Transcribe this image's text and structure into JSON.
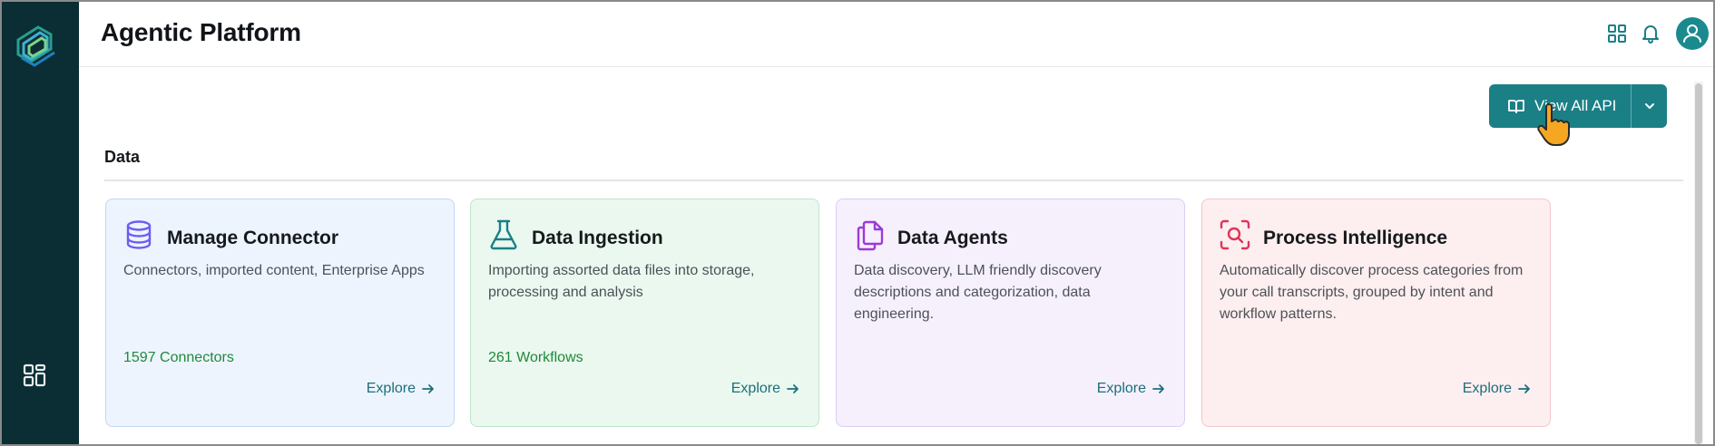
{
  "app": {
    "title": "Agentic Platform"
  },
  "header": {
    "icons": [
      "apps-grid-icon",
      "bell-icon",
      "user-icon"
    ]
  },
  "toolbar": {
    "view_all_api_label": "View All API"
  },
  "section": {
    "title": "Data"
  },
  "cards": [
    {
      "title": "Manage Connector",
      "description": "Connectors, imported content, Enterprise Apps",
      "count": "1597 Connectors",
      "action": "Explore",
      "icon": "database-icon",
      "accent": "#6d5df2"
    },
    {
      "title": "Data Ingestion",
      "description": "Importing assorted data files into storage, processing and analysis",
      "count": "261 Workflows",
      "action": "Explore",
      "icon": "flask-icon",
      "accent": "#1b7f86"
    },
    {
      "title": "Data Agents",
      "description": "Data discovery, LLM friendly discovery descriptions and categorization, data engineering.",
      "count": "",
      "action": "Explore",
      "icon": "copy-icon",
      "accent": "#9b3bd9"
    },
    {
      "title": "Process Intelligence",
      "description": "Automatically discover process categories from your call transcripts, grouped by intent and workflow patterns.",
      "count": "",
      "action": "Explore",
      "icon": "scan-search-icon",
      "accent": "#e0345a"
    }
  ],
  "colors": {
    "sidebar": "#0a2e33",
    "primary": "#1b7f86",
    "count_green": "#1f8a3a",
    "link": "#1b6f7a"
  }
}
